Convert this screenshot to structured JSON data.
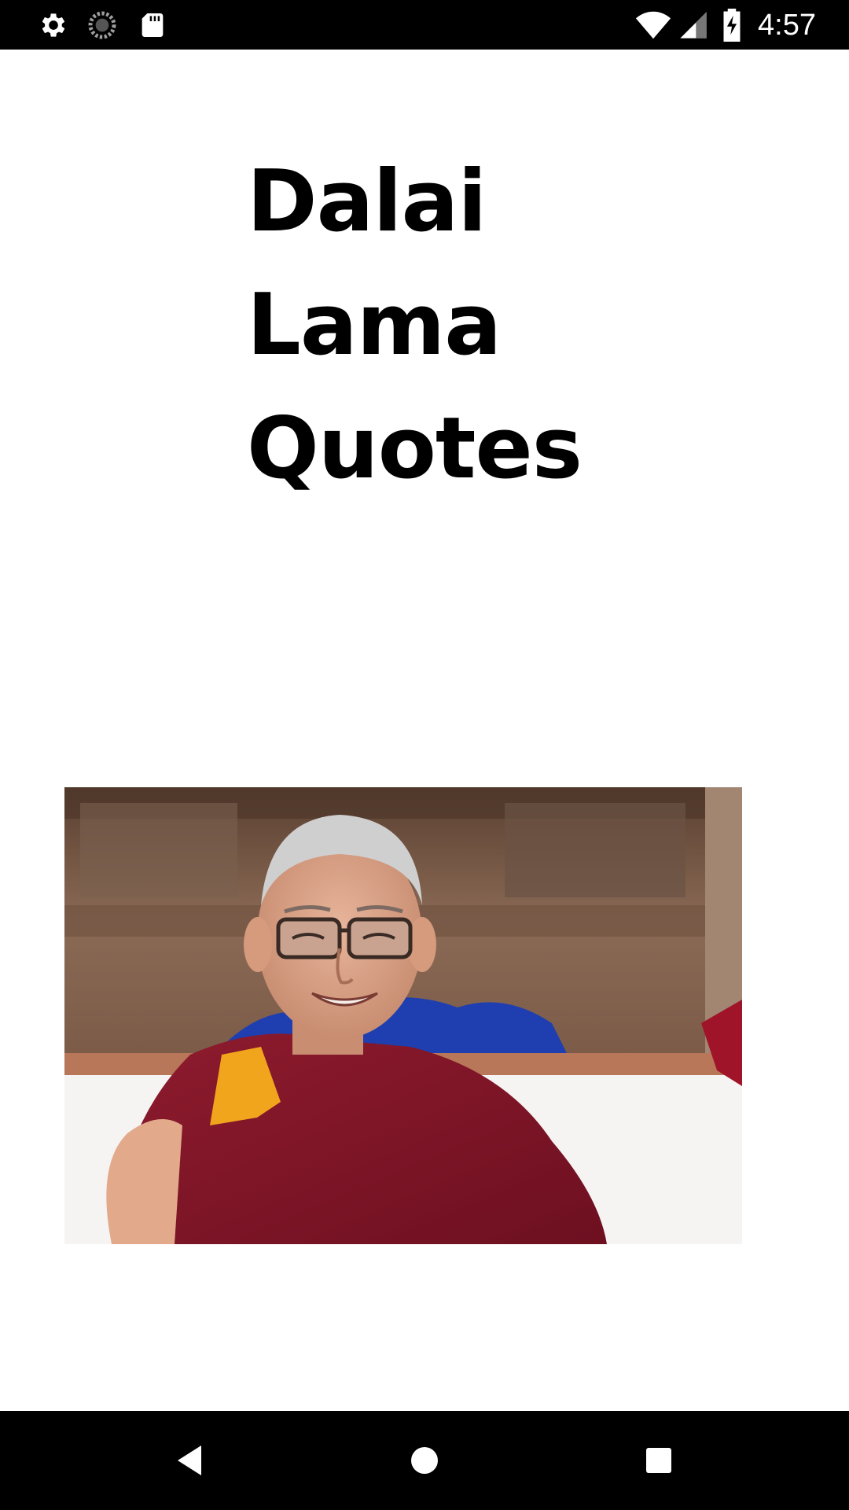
{
  "status_bar": {
    "time": "4:57",
    "left_icons": [
      "gear-icon",
      "sync-icon",
      "sd-card-icon"
    ],
    "right_icons": [
      "wifi-icon",
      "cell-signal-icon",
      "battery-charging-icon"
    ],
    "background": "#000000"
  },
  "main": {
    "title_lines": [
      "Dalai",
      "Lama",
      "Quotes"
    ],
    "image_alt_semantic": "portrait-photo"
  },
  "nav_bar": {
    "buttons": [
      "back-icon",
      "home-icon",
      "recents-icon"
    ],
    "background": "#000000"
  }
}
